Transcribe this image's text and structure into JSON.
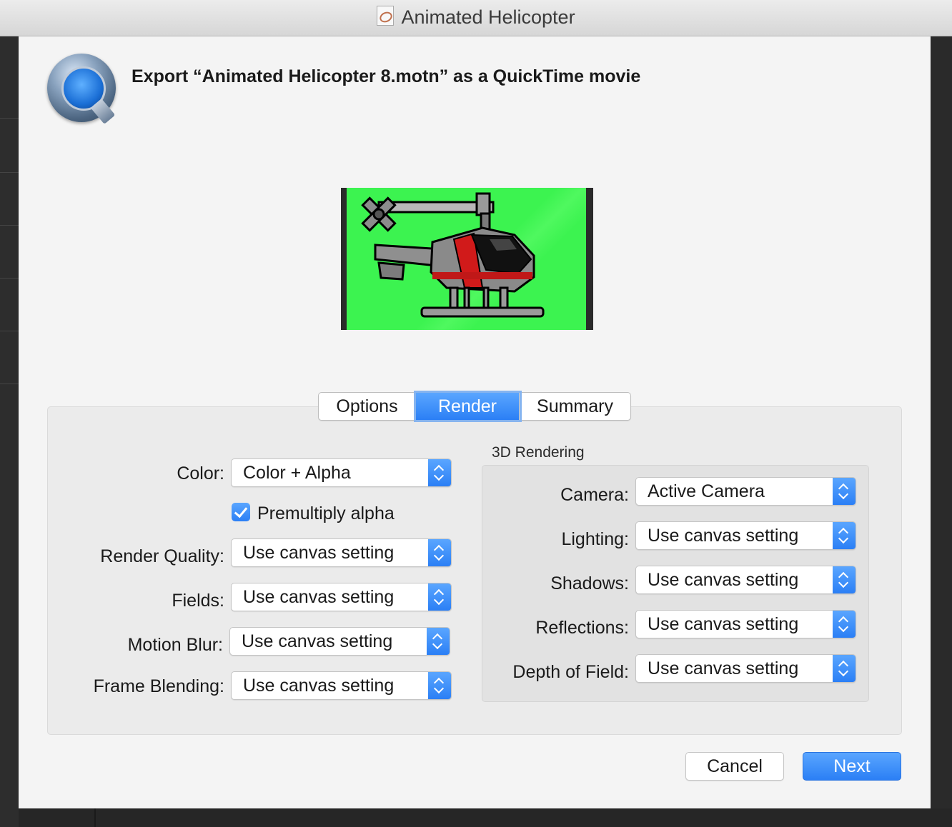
{
  "window": {
    "title": "Animated Helicopter"
  },
  "dialog": {
    "heading": "Export “Animated Helicopter 8.motn” as a QuickTime movie"
  },
  "tabs": [
    {
      "label": "Options",
      "active": false
    },
    {
      "label": "Render",
      "active": true
    },
    {
      "label": "Summary",
      "active": false
    }
  ],
  "render": {
    "color": {
      "label": "Color:",
      "value": "Color + Alpha"
    },
    "premultiply": {
      "label": "Premultiply alpha",
      "checked": true
    },
    "render_quality": {
      "label": "Render Quality:",
      "value": "Use canvas setting"
    },
    "fields": {
      "label": "Fields:",
      "value": "Use canvas setting"
    },
    "motion_blur": {
      "label": "Motion Blur:",
      "value": "Use canvas setting"
    },
    "frame_blending": {
      "label": "Frame Blending:",
      "value": "Use canvas setting"
    }
  },
  "rendering_3d": {
    "title": "3D Rendering",
    "camera": {
      "label": "Camera:",
      "value": "Active Camera"
    },
    "lighting": {
      "label": "Lighting:",
      "value": "Use canvas setting"
    },
    "shadows": {
      "label": "Shadows:",
      "value": "Use canvas setting"
    },
    "reflections": {
      "label": "Reflections:",
      "value": "Use canvas setting"
    },
    "depth_of_field": {
      "label": "Depth of Field:",
      "value": "Use canvas setting"
    }
  },
  "buttons": {
    "cancel": "Cancel",
    "next": "Next"
  },
  "colors": {
    "accent": "#2b7ff5",
    "preview_background": "#3cf350"
  }
}
